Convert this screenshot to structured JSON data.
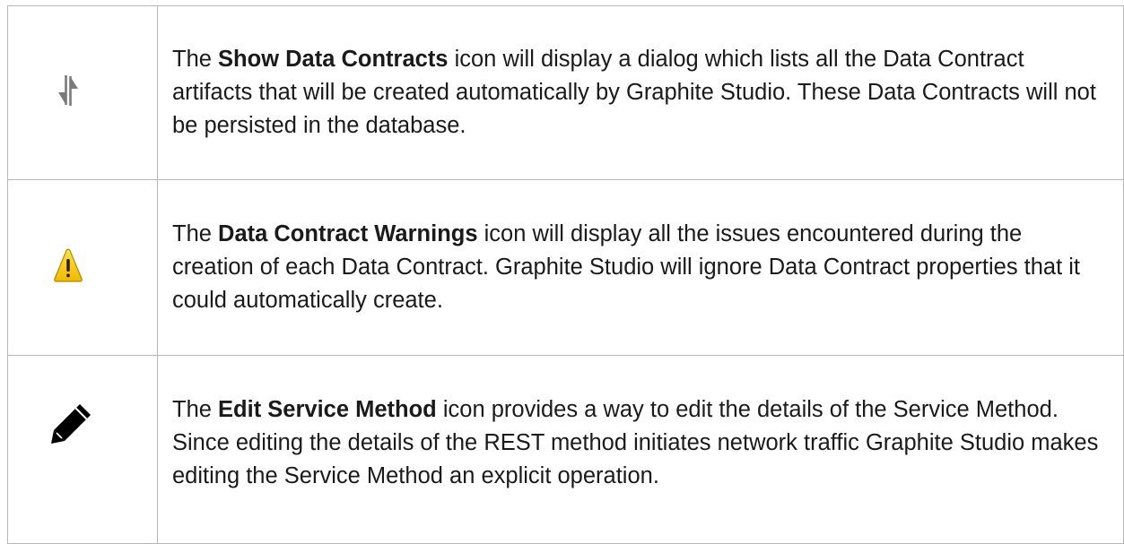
{
  "rows": [
    {
      "icon": "show-data-contracts-icon",
      "prefix": "The ",
      "name": "Show Data Contracts",
      "description": " icon will display a dialog which lists all the Data Contract artifacts that will be created automatically by Graphite Studio.  These Data Contracts will not be persisted in the database."
    },
    {
      "icon": "warning-icon",
      "prefix": "The ",
      "name": "Data Contract Warnings",
      "description": " icon will display all the issues encountered during the creation of each Data Contract.  Graphite Studio will ignore Data Contract properties that it could automatically create."
    },
    {
      "icon": "pencil-icon",
      "prefix": "The ",
      "name": "Edit Service Method",
      "description": " icon provides a way to edit the details of the Service Method.  Since editing the details of the REST method initiates network traffic Graphite Studio makes editing the Service Method an explicit operation."
    }
  ],
  "colors": {
    "border": "#b7b7b7",
    "text": "#1a1a1a",
    "arrows_icon": "#7a7a7a",
    "warning_fill": "#f5c400",
    "warning_stroke": "#b08a00",
    "pencil": "#000000"
  }
}
